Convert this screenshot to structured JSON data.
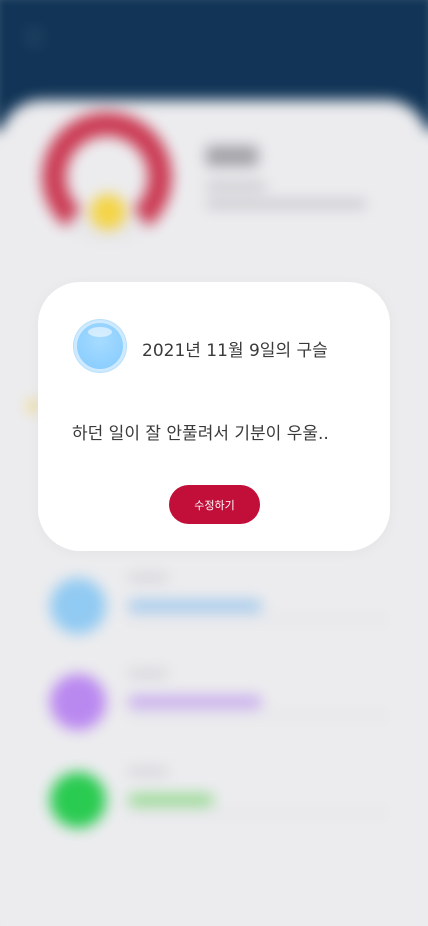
{
  "modal": {
    "title": "2021년 11월 9일의 구슬",
    "body": "하던 일이 잘 안풀려서 기분이 우울..",
    "edit_button_label": "수정하기",
    "marble_icon": "blue-marble-icon",
    "marble_color": "#8fd0ff"
  },
  "background": {
    "header_color": "#052a4e",
    "donut_color": "#c9324c",
    "donut_center_dot_color": "#f4d23e",
    "rows": [
      {
        "color": "#8cc8f2",
        "bar_color": "#9dc7ec"
      },
      {
        "color": "#b783f0",
        "bar_color": "#c3a4ee"
      },
      {
        "color": "#1fc948",
        "bar_color": "#8fd88a"
      }
    ]
  },
  "colors": {
    "accent": "#c20f3a"
  }
}
